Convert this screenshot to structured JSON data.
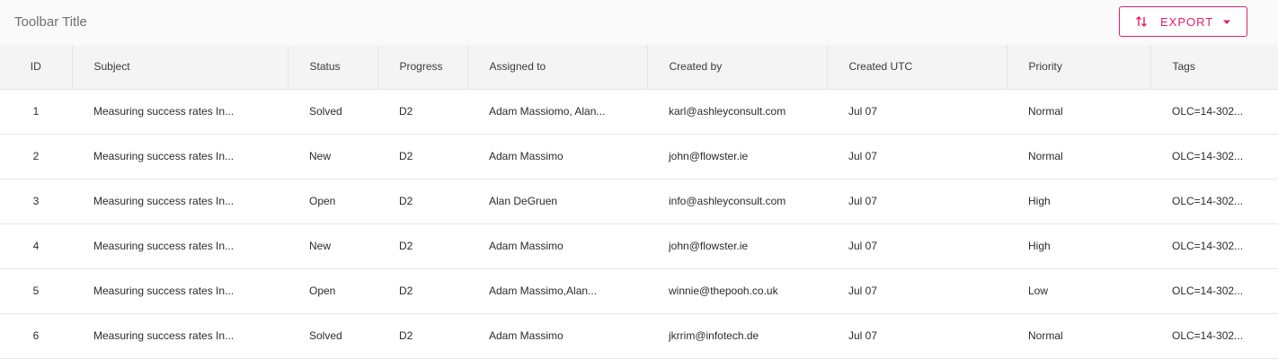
{
  "toolbar": {
    "title": "Toolbar Title",
    "export_label": "EXPORT",
    "accent_color": "#e0206e"
  },
  "columns": [
    "ID",
    "Subject",
    "Status",
    "Progress",
    "Assigned to",
    "Created by",
    "Created UTC",
    "Priority",
    "Tags"
  ],
  "rows": [
    {
      "id": "1",
      "subject": "Measuring success rates In...",
      "status": "Solved",
      "progress": "D2",
      "assigned": "Adam Massiomo, Alan...",
      "created_by": "karl@ashleyconsult.com",
      "created_utc": "Jul 07",
      "priority": "Normal",
      "tags": "OLC=14-302..."
    },
    {
      "id": "2",
      "subject": "Measuring success rates In...",
      "status": "New",
      "progress": "D2",
      "assigned": "Adam Massimo",
      "created_by": "john@flowster.ie",
      "created_utc": "Jul 07",
      "priority": "Normal",
      "tags": "OLC=14-302..."
    },
    {
      "id": "3",
      "subject": "Measuring success rates In...",
      "status": "Open",
      "progress": "D2",
      "assigned": "Alan DeGruen",
      "created_by": "info@ashleyconsult.com",
      "created_utc": "Jul 07",
      "priority": "High",
      "tags": "OLC=14-302..."
    },
    {
      "id": "4",
      "subject": "Measuring success rates In...",
      "status": "New",
      "progress": "D2",
      "assigned": "Adam Massimo",
      "created_by": "john@flowster.ie",
      "created_utc": "Jul 07",
      "priority": "High",
      "tags": "OLC=14-302..."
    },
    {
      "id": "5",
      "subject": "Measuring success rates In...",
      "status": "Open",
      "progress": "D2",
      "assigned": "Adam Massimo,Alan...",
      "created_by": "winnie@thepooh.co.uk",
      "created_utc": "Jul 07",
      "priority": "Low",
      "tags": "OLC=14-302..."
    },
    {
      "id": "6",
      "subject": "Measuring success rates In...",
      "status": "Solved",
      "progress": "D2",
      "assigned": "Adam Massimo",
      "created_by": "jkrrim@infotech.de",
      "created_utc": "Jul 07",
      "priority": "Normal",
      "tags": "OLC=14-302..."
    }
  ]
}
